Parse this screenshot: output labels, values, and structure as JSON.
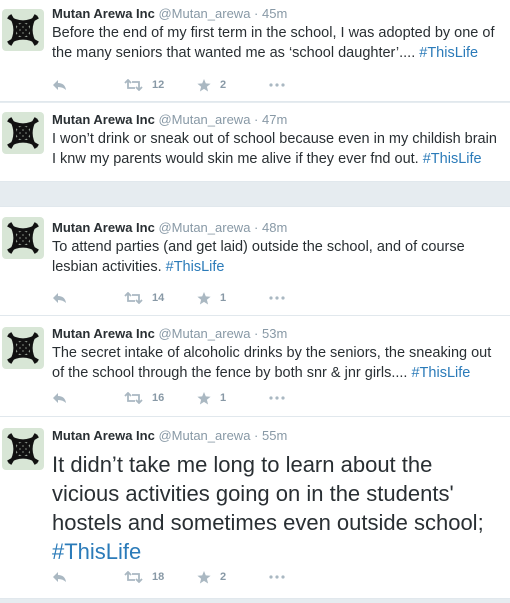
{
  "colors": {
    "hashtag": "#2b7bb9",
    "meta": "#8899a6",
    "icon": "#aab8c2"
  },
  "tweets": [
    {
      "name": "Mutan Arewa Inc",
      "handle": "@Mutan_arewa",
      "time": "· 45m",
      "text": "Before the end of my first term in the school, I was adopted by one of the many seniors that wanted me as ‘school daughter’.... ",
      "hashtag": "#ThisLife",
      "retweets": "12",
      "favorites": "2"
    },
    {
      "name": "Mutan Arewa Inc",
      "handle": "@Mutan_arewa",
      "time": "· 47m",
      "text": "I won’t drink or sneak out of school because even in my childish brain I knw my parents would skin me alive if they ever fnd out. ",
      "hashtag": "#ThisLife",
      "retweets": "",
      "favorites": ""
    },
    {
      "name": "Mutan Arewa Inc",
      "handle": "@Mutan_arewa",
      "time": "· 48m",
      "text": "To attend parties (and get laid) outside the school, and of course lesbian activities. ",
      "hashtag": "#ThisLife",
      "retweets": "14",
      "favorites": "1"
    },
    {
      "name": "Mutan Arewa Inc",
      "handle": "@Mutan_arewa",
      "time": "· 53m",
      "text": "The secret intake of alcoholic drinks by the seniors, the sneaking out of the school through the fence by both snr & jnr girls.... ",
      "hashtag": "#ThisLife",
      "retweets": "16",
      "favorites": "1"
    },
    {
      "name": "Mutan Arewa Inc",
      "handle": "@Mutan_arewa",
      "time": "· 55m",
      "text": "It didn’t take me long to learn about the vicious activities going on in the students' hostels and sometimes even outside school; ",
      "hashtag": "#ThisLife",
      "retweets": "18",
      "favorites": "2"
    }
  ]
}
